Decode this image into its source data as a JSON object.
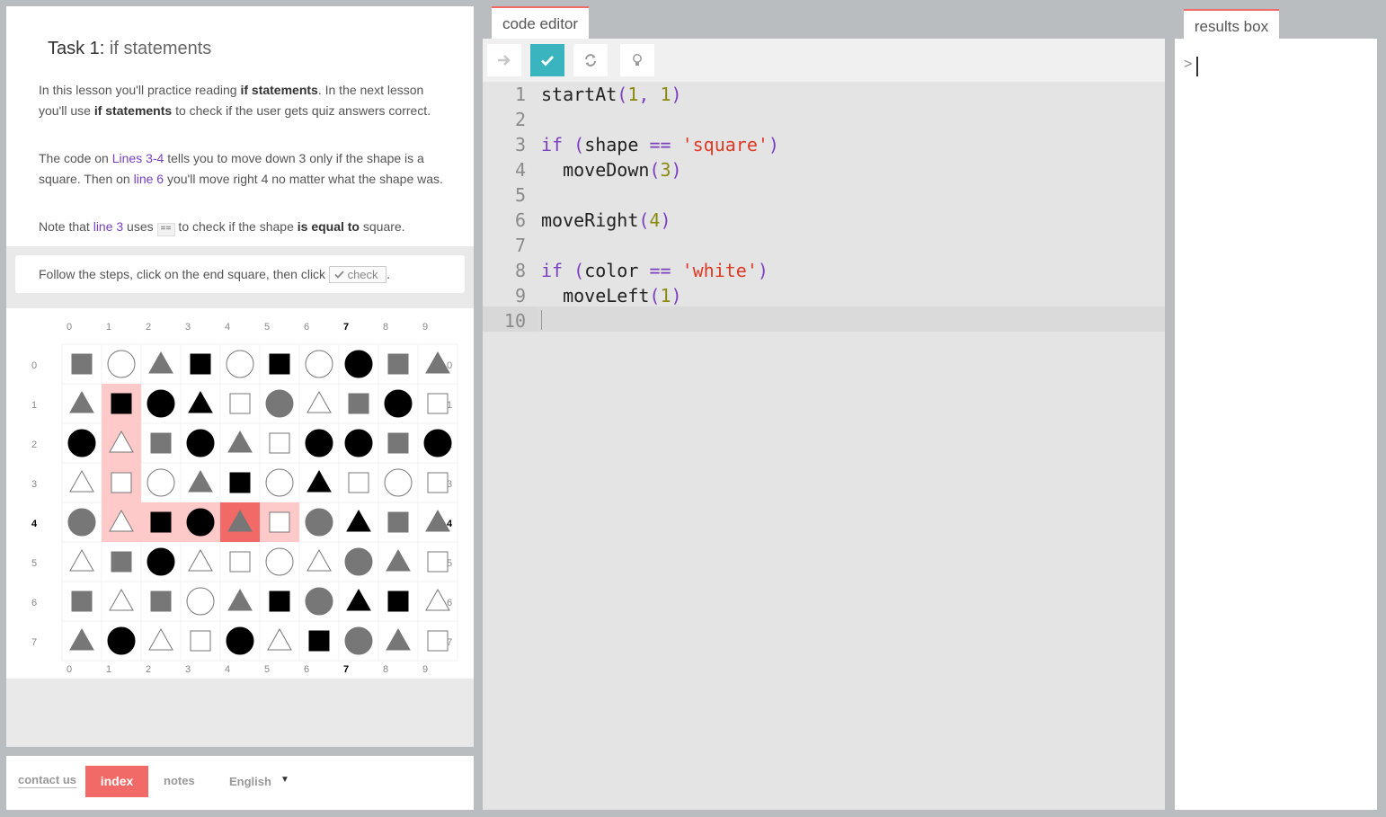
{
  "lesson": {
    "task_prefix": "Task 1:",
    "task_name": "if statements",
    "p1": [
      {
        "t": "In this lesson you'll practice reading "
      },
      {
        "t": "if statements",
        "s": "b"
      },
      {
        "t": ". In the next lesson you'll use "
      },
      {
        "t": "if statements",
        "s": "b"
      },
      {
        "t": " to check if the user gets quiz answers correct."
      }
    ],
    "p2": [
      {
        "t": "The code on "
      },
      {
        "t": "Lines 3-4",
        "s": "p"
      },
      {
        "t": " tells you to move down 3 only if the shape is a square. Then on "
      },
      {
        "t": "line 6",
        "s": "p"
      },
      {
        "t": " you'll move right 4 no matter what the shape was."
      }
    ],
    "p3": [
      {
        "t": "Note that "
      },
      {
        "t": "line 3",
        "s": "p"
      },
      {
        "t": " uses "
      },
      {
        "t": "==",
        "s": "c"
      },
      {
        "t": " to check if the shape "
      },
      {
        "t": "is equal to",
        "s": "b"
      },
      {
        "t": " square."
      }
    ],
    "steps_text": "Follow the steps, click on the end square, then click",
    "check_label": "check",
    "steps_end": "."
  },
  "grid": {
    "col_labels": [
      "0",
      "1",
      "2",
      "3",
      "4",
      "5",
      "6",
      "7",
      "8",
      "9"
    ],
    "row_labels": [
      "0",
      "1",
      "2",
      "3",
      "4",
      "5",
      "6",
      "7"
    ],
    "bold_col": 7,
    "bold_row": 4,
    "cells": [
      [
        "sq-gray",
        "ci-white",
        "tr-gray",
        "sq-black",
        "ci-white",
        "sq-black",
        "ci-white",
        "ci-black",
        "sq-gray",
        "tr-gray"
      ],
      [
        "tr-gray",
        "sq-black",
        "ci-black",
        "tr-black",
        "sq-white",
        "ci-gray",
        "tr-white",
        "sq-gray",
        "ci-black",
        "sq-white"
      ],
      [
        "ci-black",
        "tr-white",
        "sq-gray",
        "ci-black",
        "tr-gray",
        "sq-white",
        "ci-black",
        "ci-black",
        "sq-gray",
        "ci-black"
      ],
      [
        "tr-white",
        "sq-white",
        "ci-white",
        "tr-gray",
        "sq-black",
        "ci-white",
        "tr-black",
        "sq-white",
        "ci-white",
        "sq-white"
      ],
      [
        "ci-gray",
        "tr-white",
        "sq-black",
        "ci-black",
        "tr-gray",
        "sq-white",
        "ci-gray",
        "tr-black",
        "sq-gray",
        "tr-gray"
      ],
      [
        "tr-white",
        "sq-gray",
        "ci-black",
        "tr-white",
        "sq-white",
        "ci-white",
        "tr-white",
        "ci-gray",
        "tr-gray",
        "sq-white"
      ],
      [
        "sq-gray",
        "tr-white",
        "sq-gray",
        "ci-white",
        "tr-gray",
        "sq-black",
        "ci-gray",
        "tr-black",
        "sq-black",
        "tr-white"
      ],
      [
        "tr-gray",
        "ci-black",
        "tr-white",
        "sq-white",
        "ci-black",
        "tr-white",
        "sq-black",
        "ci-gray",
        "tr-gray",
        "sq-white"
      ]
    ],
    "path_cells": [
      [
        1,
        1
      ],
      [
        1,
        2
      ],
      [
        1,
        3
      ],
      [
        1,
        4
      ],
      [
        2,
        4
      ],
      [
        3,
        4
      ],
      [
        5,
        4
      ]
    ],
    "current_cell": [
      4,
      4
    ],
    "path_color": "#fdc9c9",
    "current_color": "#f26a67"
  },
  "footer": {
    "contact": "contact us",
    "index": "index",
    "notes": "notes",
    "language": "English",
    "caret": "▼"
  },
  "editor": {
    "tab": "code editor",
    "buttons": [
      "run-arrow-icon",
      "check-icon",
      "refresh-icon",
      "lightbulb-icon"
    ],
    "accent": "#3ab5c0",
    "line_numbers": [
      "1",
      "2",
      "3",
      "4",
      "5",
      "6",
      "7",
      "8",
      "9",
      "10"
    ],
    "lines": [
      [
        {
          "t": "startAt",
          "c": ""
        },
        {
          "t": "(",
          "c": "pn"
        },
        {
          "t": "1",
          "c": "num"
        },
        {
          "t": ", ",
          "c": "pn"
        },
        {
          "t": "1",
          "c": "num"
        },
        {
          "t": ")",
          "c": "pn"
        }
      ],
      [],
      [
        {
          "t": "if",
          "c": "kw"
        },
        {
          "t": " (",
          "c": "pn"
        },
        {
          "t": "shape ",
          "c": ""
        },
        {
          "t": "==",
          "c": "op"
        },
        {
          "t": " ",
          "c": ""
        },
        {
          "t": "'square'",
          "c": "str"
        },
        {
          "t": ")",
          "c": "pn"
        }
      ],
      [
        {
          "t": "  moveDown",
          "c": ""
        },
        {
          "t": "(",
          "c": "pn"
        },
        {
          "t": "3",
          "c": "num"
        },
        {
          "t": ")",
          "c": "pn"
        }
      ],
      [],
      [
        {
          "t": "moveRight",
          "c": ""
        },
        {
          "t": "(",
          "c": "pn"
        },
        {
          "t": "4",
          "c": "num"
        },
        {
          "t": ")",
          "c": "pn"
        }
      ],
      [],
      [
        {
          "t": "if",
          "c": "kw"
        },
        {
          "t": " (",
          "c": "pn"
        },
        {
          "t": "color ",
          "c": ""
        },
        {
          "t": "==",
          "c": "op"
        },
        {
          "t": " ",
          "c": ""
        },
        {
          "t": "'white'",
          "c": "str"
        },
        {
          "t": ")",
          "c": "pn"
        }
      ],
      [
        {
          "t": "  moveLeft",
          "c": ""
        },
        {
          "t": "(",
          "c": "pn"
        },
        {
          "t": "1",
          "c": "num"
        },
        {
          "t": ")",
          "c": "pn"
        }
      ],
      []
    ]
  },
  "results": {
    "tab": "results box",
    "prompt": ">"
  }
}
